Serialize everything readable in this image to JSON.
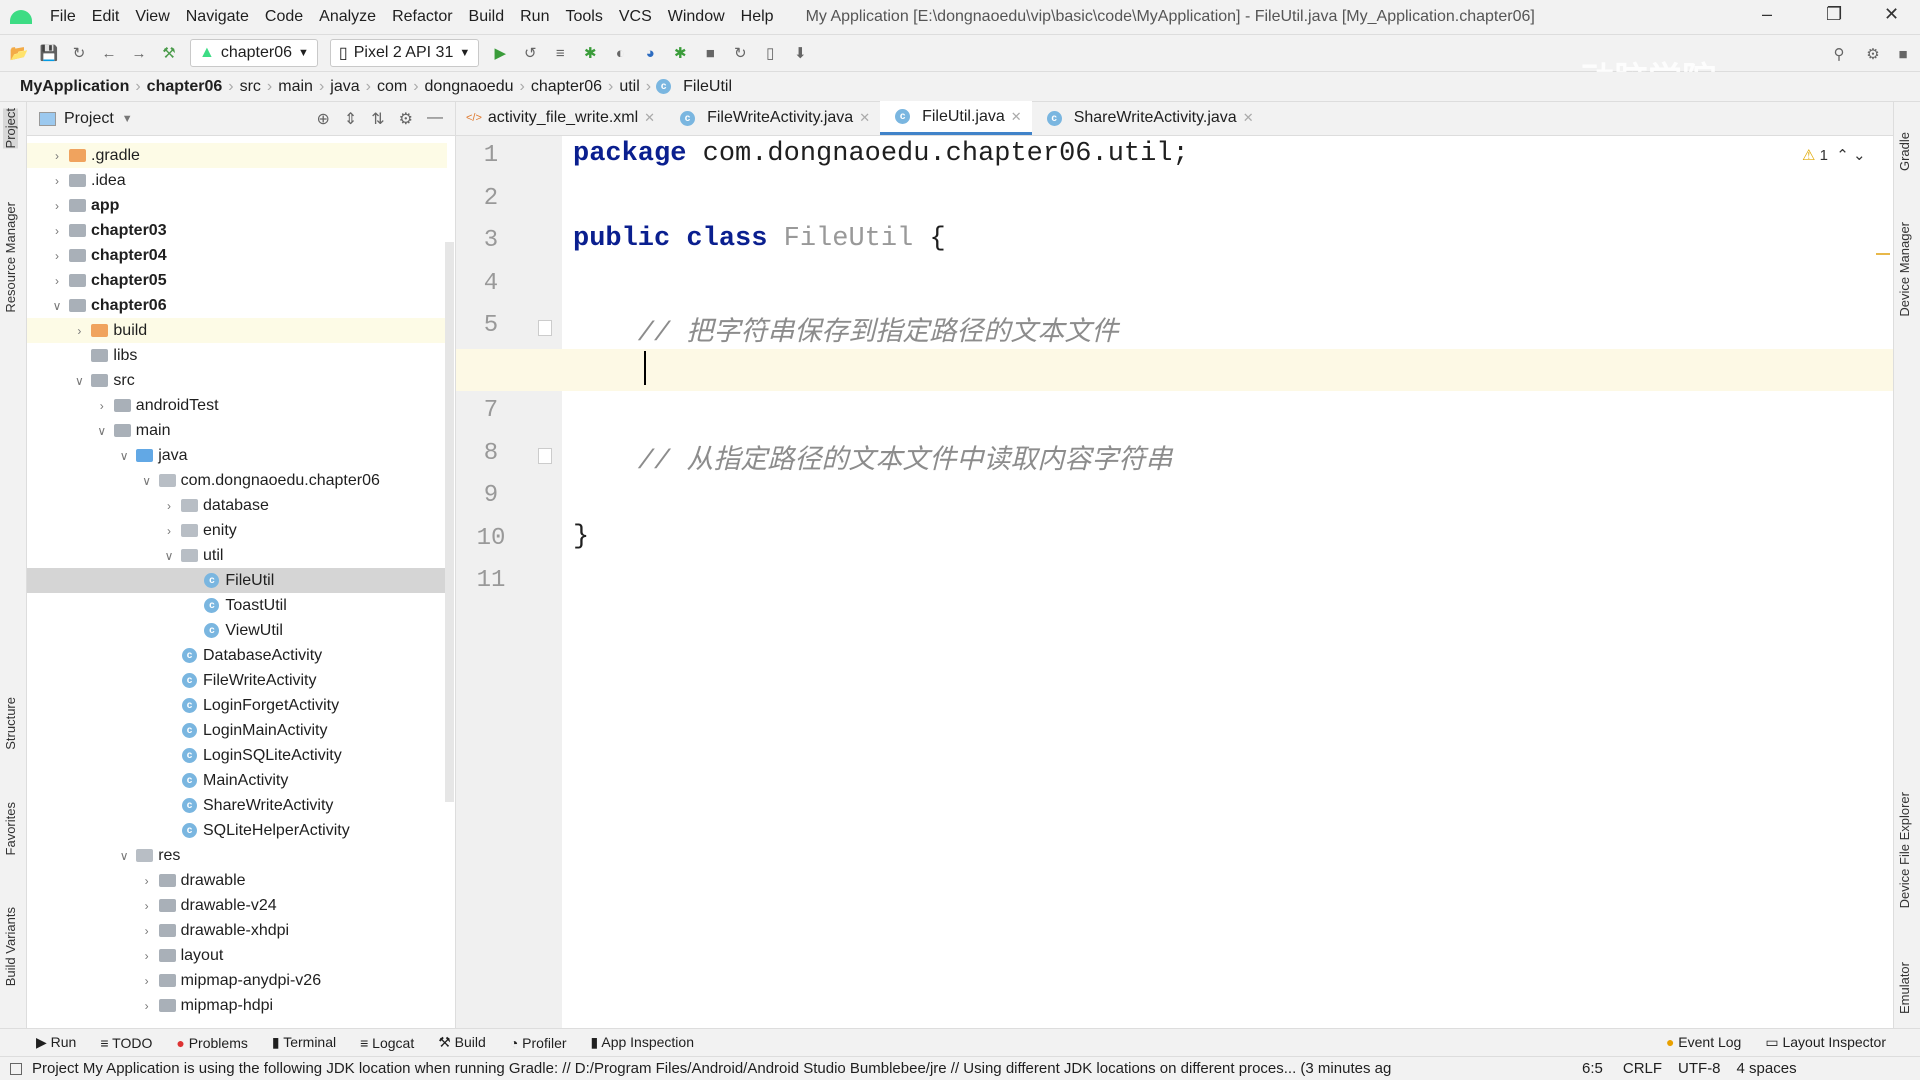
{
  "menubar": {
    "items": [
      "File",
      "Edit",
      "View",
      "Navigate",
      "Code",
      "Analyze",
      "Refactor",
      "Build",
      "Run",
      "Tools",
      "VCS",
      "Window",
      "Help"
    ],
    "title": "My Application [E:\\dongnaoedu\\vip\\basic\\code\\MyApplication] - FileUtil.java [My_Application.chapter06]"
  },
  "toolbar": {
    "module": "chapter06",
    "device": "Pixel 2 API 31"
  },
  "watermark": "动脑学院",
  "breadcrumb": [
    "MyApplication",
    "chapter06",
    "src",
    "main",
    "java",
    "com",
    "dongnaoedu",
    "chapter06",
    "util",
    "FileUtil"
  ],
  "left_stripe": [
    "Project",
    "Resource Manager",
    "Structure",
    "Favorites",
    "Build Variants"
  ],
  "right_stripe": [
    "Gradle",
    "Device Manager",
    "Device File Explorer",
    "Emulator"
  ],
  "project": {
    "title": "Project",
    "tree": [
      {
        "label": ".gradle",
        "level": 0,
        "type": "folder-excluded",
        "state": "collapsed"
      },
      {
        "label": ".idea",
        "level": 0,
        "type": "folder",
        "state": "collapsed"
      },
      {
        "label": "app",
        "level": 0,
        "type": "module",
        "state": "collapsed"
      },
      {
        "label": "chapter03",
        "level": 0,
        "type": "module",
        "state": "collapsed"
      },
      {
        "label": "chapter04",
        "level": 0,
        "type": "module",
        "state": "collapsed"
      },
      {
        "label": "chapter05",
        "level": 0,
        "type": "module",
        "state": "collapsed"
      },
      {
        "label": "chapter06",
        "level": 0,
        "type": "module",
        "state": "expanded"
      },
      {
        "label": "build",
        "level": 1,
        "type": "folder-excluded",
        "state": "collapsed"
      },
      {
        "label": "libs",
        "level": 1,
        "type": "folder",
        "state": "none"
      },
      {
        "label": "src",
        "level": 1,
        "type": "folder",
        "state": "expanded"
      },
      {
        "label": "androidTest",
        "level": 2,
        "type": "folder",
        "state": "collapsed"
      },
      {
        "label": "main",
        "level": 2,
        "type": "folder",
        "state": "expanded"
      },
      {
        "label": "java",
        "level": 3,
        "type": "folder-source",
        "state": "expanded"
      },
      {
        "label": "com.dongnaoedu.chapter06",
        "level": 4,
        "type": "package",
        "state": "expanded"
      },
      {
        "label": "database",
        "level": 5,
        "type": "package",
        "state": "collapsed"
      },
      {
        "label": "enity",
        "level": 5,
        "type": "package",
        "state": "collapsed"
      },
      {
        "label": "util",
        "level": 5,
        "type": "package",
        "state": "expanded"
      },
      {
        "label": "FileUtil",
        "level": 6,
        "type": "class",
        "state": "none",
        "selected": true
      },
      {
        "label": "ToastUtil",
        "level": 6,
        "type": "class",
        "state": "none"
      },
      {
        "label": "ViewUtil",
        "level": 6,
        "type": "class",
        "state": "none"
      },
      {
        "label": "DatabaseActivity",
        "level": 5,
        "type": "class",
        "state": "none"
      },
      {
        "label": "FileWriteActivity",
        "level": 5,
        "type": "class",
        "state": "none"
      },
      {
        "label": "LoginForgetActivity",
        "level": 5,
        "type": "class",
        "state": "none"
      },
      {
        "label": "LoginMainActivity",
        "level": 5,
        "type": "class",
        "state": "none"
      },
      {
        "label": "LoginSQLiteActivity",
        "level": 5,
        "type": "class",
        "state": "none"
      },
      {
        "label": "MainActivity",
        "level": 5,
        "type": "class",
        "state": "none"
      },
      {
        "label": "ShareWriteActivity",
        "level": 5,
        "type": "class",
        "state": "none"
      },
      {
        "label": "SQLiteHelperActivity",
        "level": 5,
        "type": "class",
        "state": "none"
      },
      {
        "label": "res",
        "level": 3,
        "type": "folder-res",
        "state": "expanded"
      },
      {
        "label": "drawable",
        "level": 4,
        "type": "folder",
        "state": "collapsed"
      },
      {
        "label": "drawable-v24",
        "level": 4,
        "type": "folder",
        "state": "collapsed"
      },
      {
        "label": "drawable-xhdpi",
        "level": 4,
        "type": "folder",
        "state": "collapsed"
      },
      {
        "label": "layout",
        "level": 4,
        "type": "folder",
        "state": "collapsed"
      },
      {
        "label": "mipmap-anydpi-v26",
        "level": 4,
        "type": "folder",
        "state": "collapsed"
      },
      {
        "label": "mipmap-hdpi",
        "level": 4,
        "type": "folder",
        "state": "collapsed"
      }
    ]
  },
  "tabs": [
    {
      "label": "activity_file_write.xml",
      "icon": "xml"
    },
    {
      "label": "FileWriteActivity.java",
      "icon": "class"
    },
    {
      "label": "FileUtil.java",
      "icon": "class",
      "active": true
    },
    {
      "label": "ShareWriteActivity.java",
      "icon": "class"
    }
  ],
  "editor": {
    "warnings": "1",
    "lines": [
      [
        {
          "t": "package",
          "c": "kw"
        },
        {
          "t": " com.dongnaoedu.chapter06.util;",
          "c": ""
        }
      ],
      [],
      [
        {
          "t": "public class",
          "c": "kw"
        },
        {
          "t": " FileUtil",
          "c": "cn"
        },
        {
          "t": " {",
          "c": ""
        }
      ],
      [],
      [
        {
          "t": "    // 把字符串保存到指定路径的文本文件",
          "c": "cm"
        }
      ],
      [],
      [],
      [
        {
          "t": "    // 从指定路径的文本文件中读取内容字符串",
          "c": "cm"
        }
      ],
      [],
      [
        {
          "t": "}",
          "c": ""
        }
      ],
      []
    ],
    "current_line": 6
  },
  "bottom_tools": [
    "Run",
    "TODO",
    "Problems",
    "Terminal",
    "Logcat",
    "Build",
    "Profiler",
    "App Inspection"
  ],
  "bottom_right_tools": [
    "Event Log",
    "Layout Inspector"
  ],
  "status": {
    "message": "Project My Application is using the following JDK location when running Gradle: // D:/Program Files/Android/Android Studio Bumblebee/jre // Using different JDK locations on different proces... (3 minutes ag",
    "position": "6:5",
    "line_sep": "CRLF",
    "encoding": "UTF-8",
    "indent": "4 spaces"
  },
  "colors": {
    "accent": "#4083c9",
    "keyword": "#0a1f8f",
    "current_line": "#fdf9e5"
  }
}
